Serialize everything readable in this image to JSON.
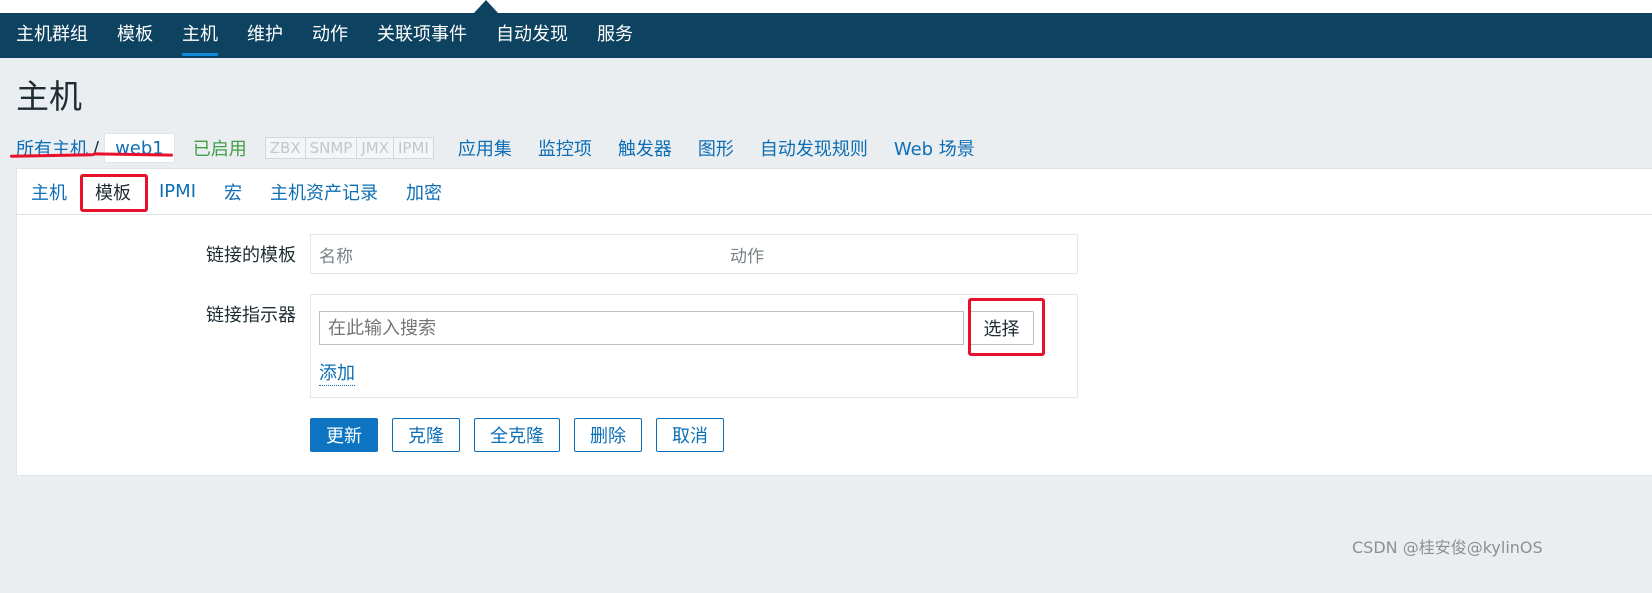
{
  "topnav": {
    "items": [
      {
        "label": "主机群组",
        "active": false
      },
      {
        "label": "模板",
        "active": false
      },
      {
        "label": "主机",
        "active": true
      },
      {
        "label": "维护",
        "active": false
      },
      {
        "label": "动作",
        "active": false
      },
      {
        "label": "关联项事件",
        "active": false
      },
      {
        "label": "自动发现",
        "active": false
      },
      {
        "label": "服务",
        "active": false
      }
    ]
  },
  "page": {
    "title": "主机"
  },
  "hostbar": {
    "all_hosts": "所有主机",
    "separator": "/",
    "host_name": "web1",
    "status": "已启用",
    "availability": [
      "ZBX",
      "SNMP",
      "JMX",
      "IPMI"
    ],
    "links": [
      "应用集",
      "监控项",
      "触发器",
      "图形",
      "自动发现规则",
      "Web 场景"
    ]
  },
  "tabs": [
    {
      "label": "主机",
      "active": false
    },
    {
      "label": "模板",
      "active": true
    },
    {
      "label": "IPMI",
      "active": false
    },
    {
      "label": "宏",
      "active": false
    },
    {
      "label": "主机资产记录",
      "active": false
    },
    {
      "label": "加密",
      "active": false
    }
  ],
  "form": {
    "linked_templates_label": "链接的模板",
    "table_col_name": "名称",
    "table_col_action": "动作",
    "link_indicator_label": "链接指示器",
    "search_placeholder": "在此输入搜索",
    "select_button": "选择",
    "add_link": "添加"
  },
  "buttons": {
    "update": "更新",
    "clone": "克隆",
    "full_clone": "全克隆",
    "delete": "删除",
    "cancel": "取消"
  },
  "watermark": "CSDN @桂安俊@kylinOS",
  "colors": {
    "nav_bg": "#0e4261",
    "link": "#0d6eb5",
    "status_enabled": "#429e47",
    "highlight": "#e8102b",
    "primary_button": "#0d74c2"
  }
}
